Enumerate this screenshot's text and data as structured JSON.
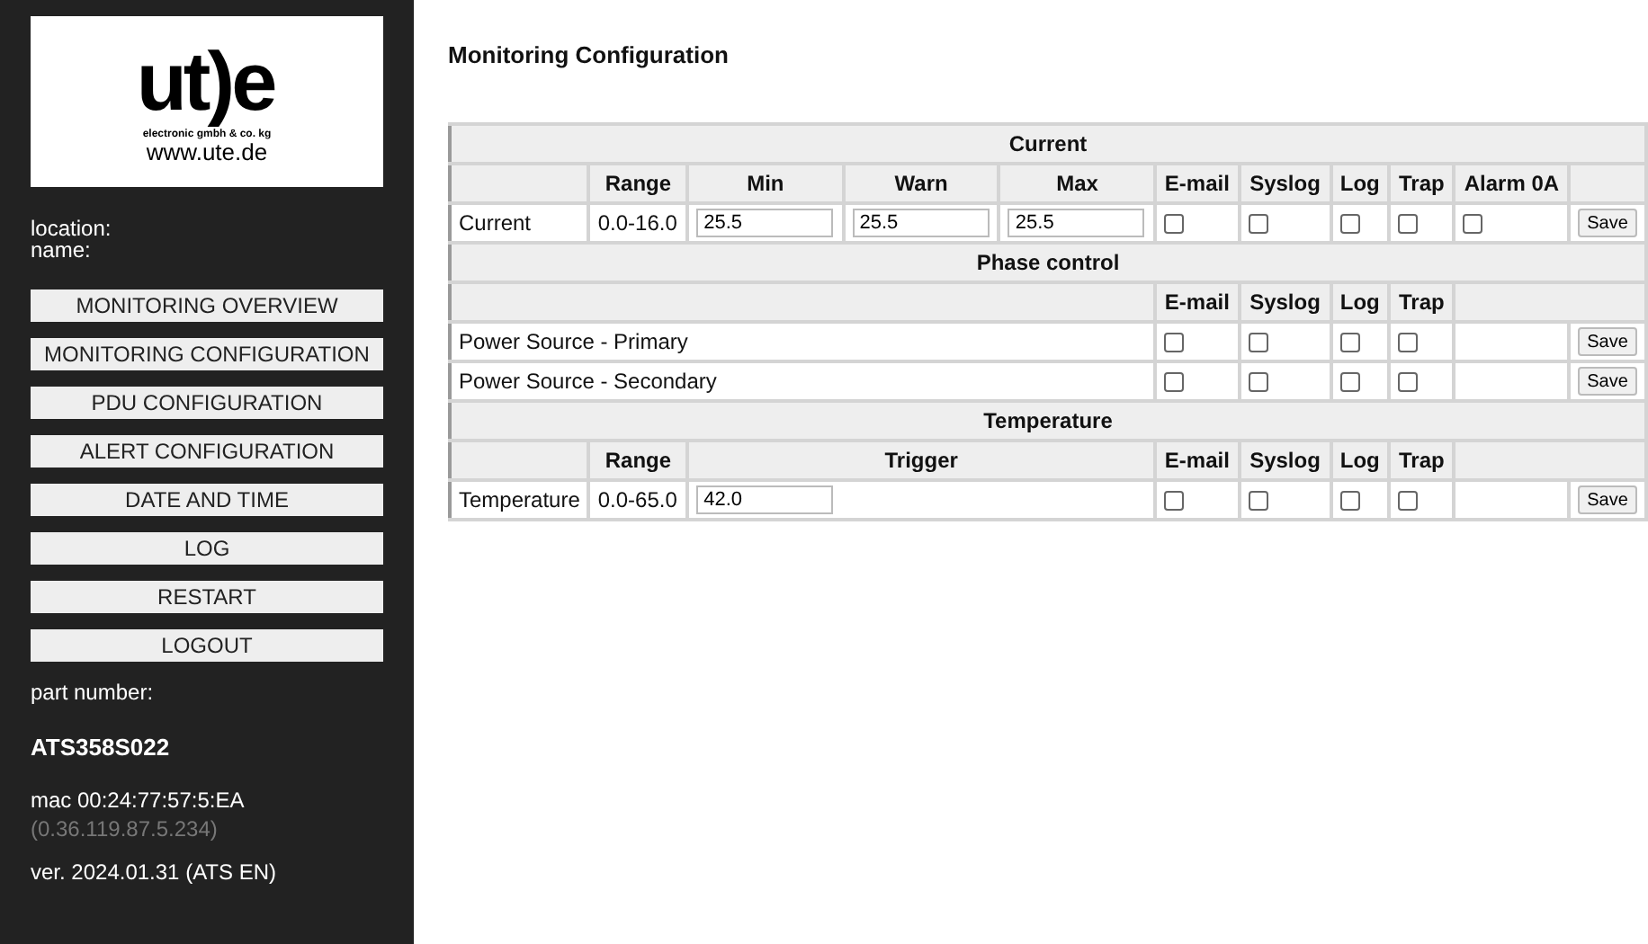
{
  "sidebar": {
    "logo": {
      "mark": "ut)e",
      "tagline": "electronic gmbh & co. kg",
      "url": "www.ute.de"
    },
    "location_label": "location:",
    "name_label": "name:",
    "menu": [
      {
        "label": "MONITORING OVERVIEW"
      },
      {
        "label": "MONITORING CONFIGURATION"
      },
      {
        "label": "PDU CONFIGURATION"
      },
      {
        "label": "ALERT CONFIGURATION"
      },
      {
        "label": "DATE AND TIME"
      },
      {
        "label": "LOG"
      },
      {
        "label": "RESTART"
      },
      {
        "label": "LOGOUT"
      }
    ],
    "part_number_label": "part number:",
    "part_number": "ATS358S022",
    "mac": "mac 00:24:77:57:5:EA",
    "ip": "(0.36.119.87.5.234)",
    "version": "ver. 2024.01.31 (ATS EN)"
  },
  "page_title": "Monitoring Configuration",
  "sections": [
    {
      "title": "Current",
      "kind": "thresholds",
      "columns": [
        "Range",
        "Min",
        "Warn",
        "Max",
        "E-mail",
        "Syslog",
        "Log",
        "Trap",
        "Alarm 0A"
      ],
      "rows": [
        {
          "name": "Current",
          "range": "0.0-16.0",
          "min": "25.5",
          "warn": "25.5",
          "max": "25.5",
          "flags": [
            {
              "checked": false
            },
            {
              "checked": false
            },
            {
              "checked": false
            },
            {
              "checked": false
            },
            {
              "checked": false
            }
          ],
          "button": "Save"
        }
      ]
    },
    {
      "title": "Phase control",
      "kind": "switches",
      "columns": [
        "E-mail",
        "Syslog",
        "Log",
        "Trap"
      ],
      "rows": [
        {
          "name": "Power Source - Primary",
          "flags": [
            {
              "checked": false
            },
            {
              "checked": false
            },
            {
              "checked": false
            },
            {
              "checked": false
            }
          ],
          "button": "Save"
        },
        {
          "name": "Power Source - Secondary",
          "flags": [
            {
              "checked": false
            },
            {
              "checked": false
            },
            {
              "checked": false
            },
            {
              "checked": false
            }
          ],
          "button": "Save"
        }
      ]
    },
    {
      "title": "Temperature",
      "kind": "trigger",
      "columns": [
        "Range",
        "Trigger",
        "E-mail",
        "Syslog",
        "Log",
        "Trap"
      ],
      "rows": [
        {
          "name": "Temperature",
          "range": "0.0-65.0",
          "trigger": "42.0",
          "flags": [
            {
              "checked": false
            },
            {
              "checked": false
            },
            {
              "checked": false
            },
            {
              "checked": false
            }
          ],
          "button": "Save"
        }
      ]
    }
  ]
}
